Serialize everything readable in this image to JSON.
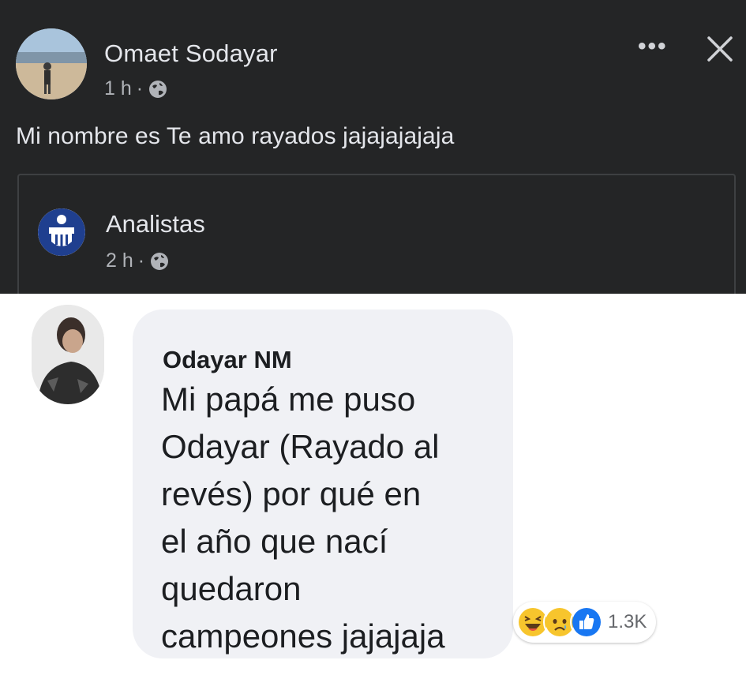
{
  "post": {
    "author": "Omaet Sodayar",
    "time": "1 h",
    "separator": "·",
    "text": "Mi nombre es Te amo rayados jajajajajaja",
    "more_label": "•••"
  },
  "shared_post": {
    "page_name": "Analistas",
    "time": "2 h",
    "separator": "·"
  },
  "comment": {
    "author": "Odayar NM",
    "text": "Mi papá me puso\nOdayar (Rayado al\nrevés) por qué en\nel año que nací\nquedaron\ncampeones jajajaja",
    "reaction_count": "1.3K",
    "reactions": [
      "haha-icon",
      "sad-icon",
      "like-icon"
    ]
  },
  "colors": {
    "dark_bg": "#242526",
    "text_primary": "#e4e6eb",
    "text_secondary": "#b0b3b8",
    "bubble_bg": "#f0f1f5",
    "like_blue": "#1877f2",
    "emoji_yellow": "#f7c52d"
  }
}
